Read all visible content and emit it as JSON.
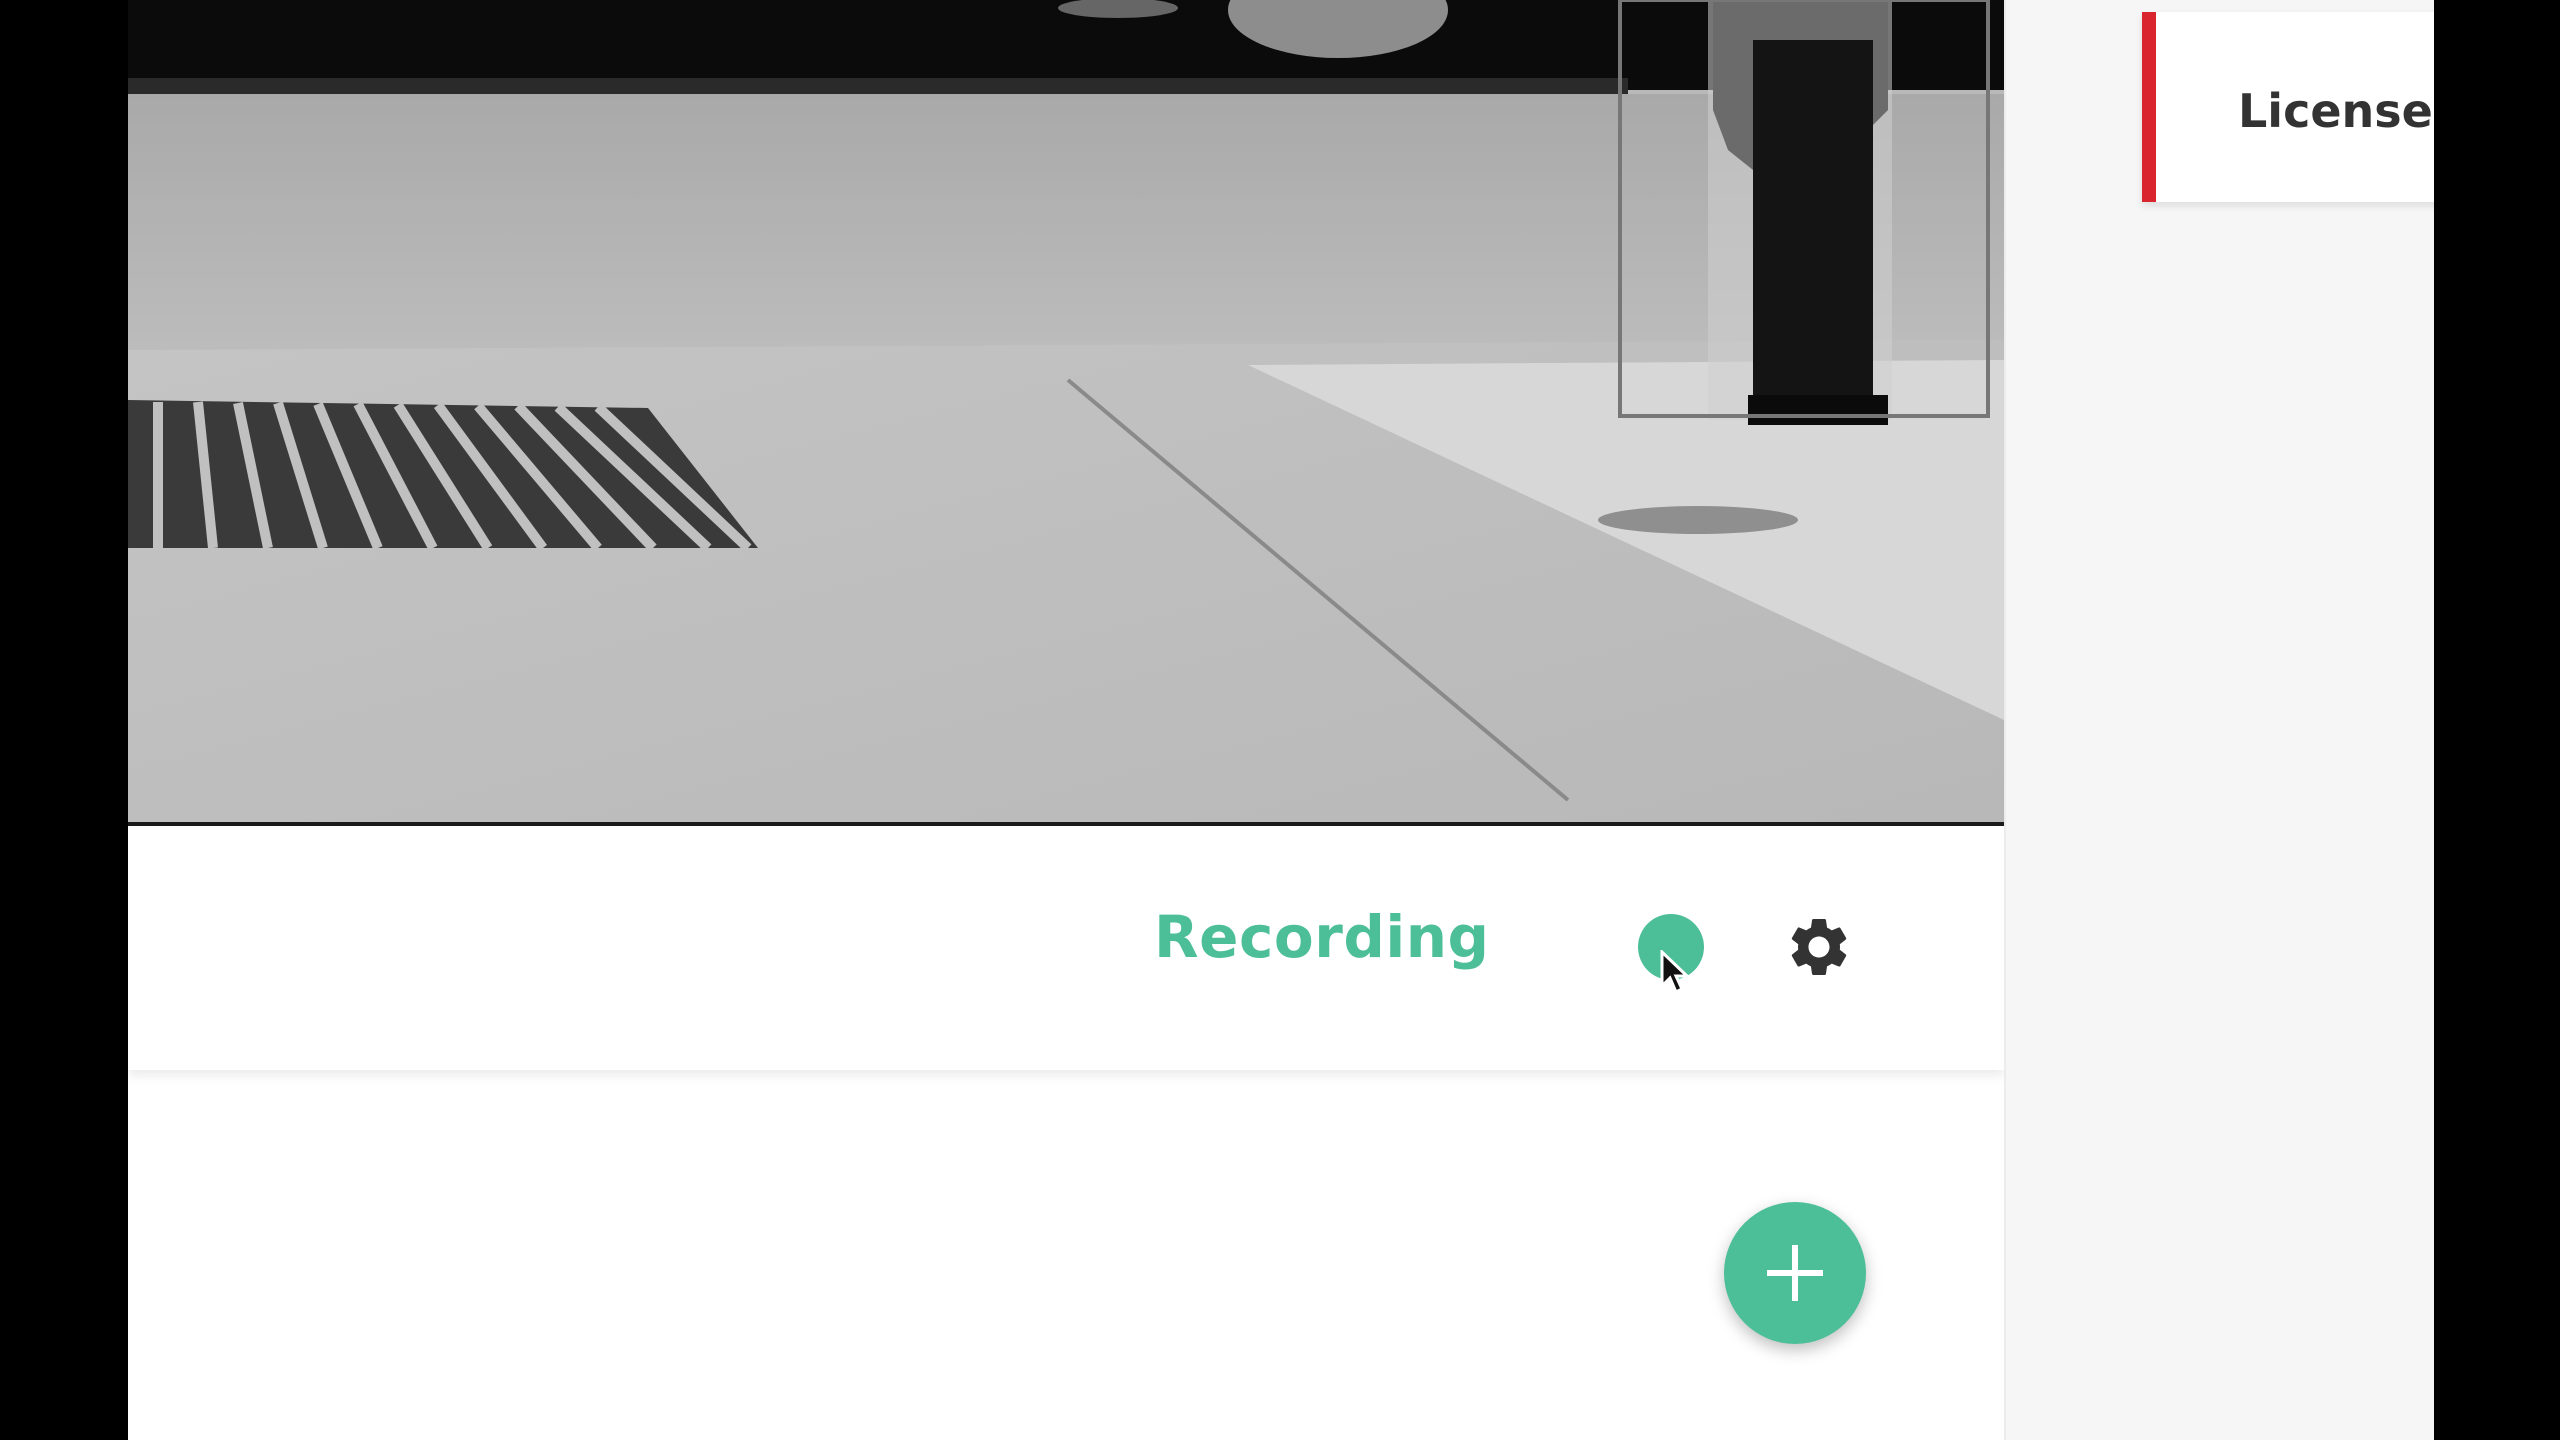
{
  "camera": {
    "recording_label": "Recording",
    "recording_color": "#4dbf98"
  },
  "controls": {
    "record_toggle_icon": "record-dot-icon",
    "settings_icon": "gear-icon",
    "add_icon": "plus-icon"
  },
  "side_panel": {
    "card_title": "License p",
    "card_accent_color": "#d9262e"
  }
}
